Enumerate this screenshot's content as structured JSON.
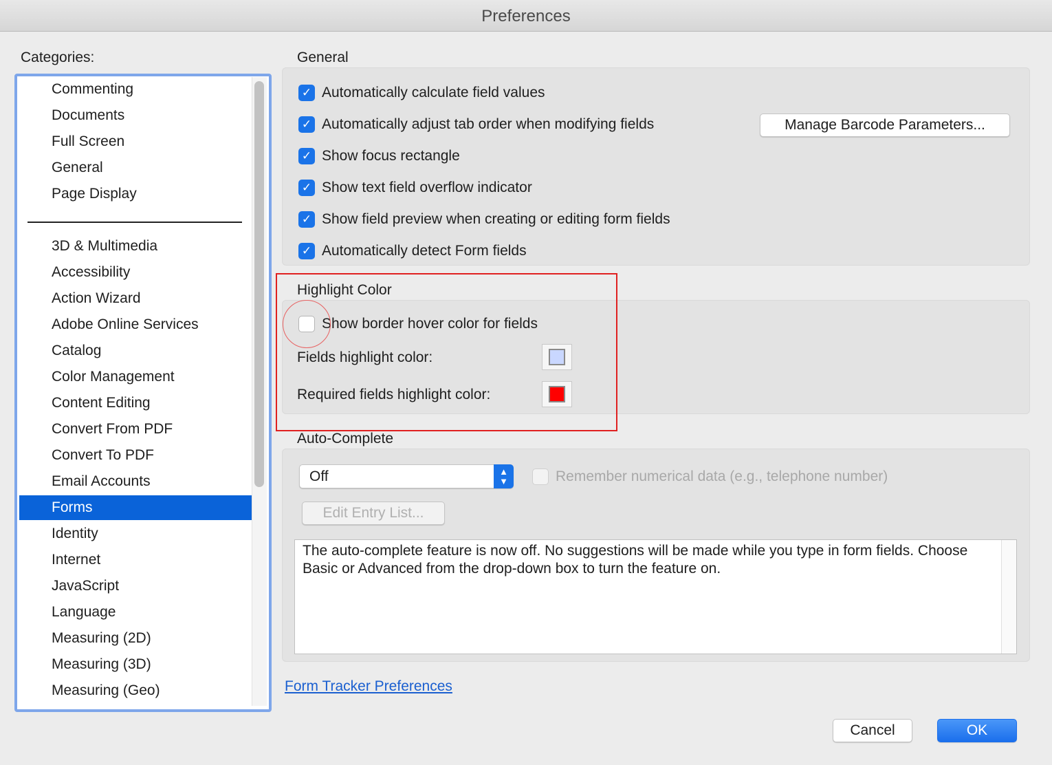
{
  "window": {
    "title": "Preferences"
  },
  "sidebar": {
    "label": "Categories:",
    "selected": "Forms",
    "items": [
      "Commenting",
      "Documents",
      "Full Screen",
      "General",
      "Page Display",
      "3D & Multimedia",
      "Accessibility",
      "Action Wizard",
      "Adobe Online Services",
      "Catalog",
      "Color Management",
      "Content Editing",
      "Convert From PDF",
      "Convert To PDF",
      "Email Accounts",
      "Forms",
      "Identity",
      "Internet",
      "JavaScript",
      "Language",
      "Measuring (2D)",
      "Measuring (3D)",
      "Measuring (Geo)"
    ]
  },
  "general": {
    "title": "General",
    "options": [
      {
        "label": "Automatically calculate field values",
        "checked": true
      },
      {
        "label": "Automatically adjust tab order when modifying fields",
        "checked": true
      },
      {
        "label": "Show focus rectangle",
        "checked": true
      },
      {
        "label": "Show text field overflow indicator",
        "checked": true
      },
      {
        "label": "Show field preview when creating or editing form fields",
        "checked": true
      },
      {
        "label": "Automatically detect Form fields",
        "checked": true
      }
    ],
    "barcode_button": "Manage Barcode Parameters..."
  },
  "highlight": {
    "title": "Highlight Color",
    "hover_label": "Show border hover color for fields",
    "hover_checked": false,
    "fields_label": "Fields highlight color:",
    "fields_color": "#c9d7ff",
    "required_label": "Required fields highlight color:",
    "required_color": "#ff0000"
  },
  "autocomplete": {
    "title": "Auto-Complete",
    "select_value": "Off",
    "remember_label": "Remember numerical data (e.g., telephone number)",
    "remember_checked": false,
    "edit_button": "Edit Entry List...",
    "description": "The auto-complete feature is now off. No suggestions will be made while you type in form fields. Choose Basic or Advanced from the drop-down box to turn the feature on."
  },
  "link": "Form Tracker Preferences",
  "footer": {
    "cancel": "Cancel",
    "ok": "OK"
  },
  "colors": {
    "accent": "#1a73e8",
    "selection": "#0a63d9",
    "annotation": "#e02020"
  }
}
